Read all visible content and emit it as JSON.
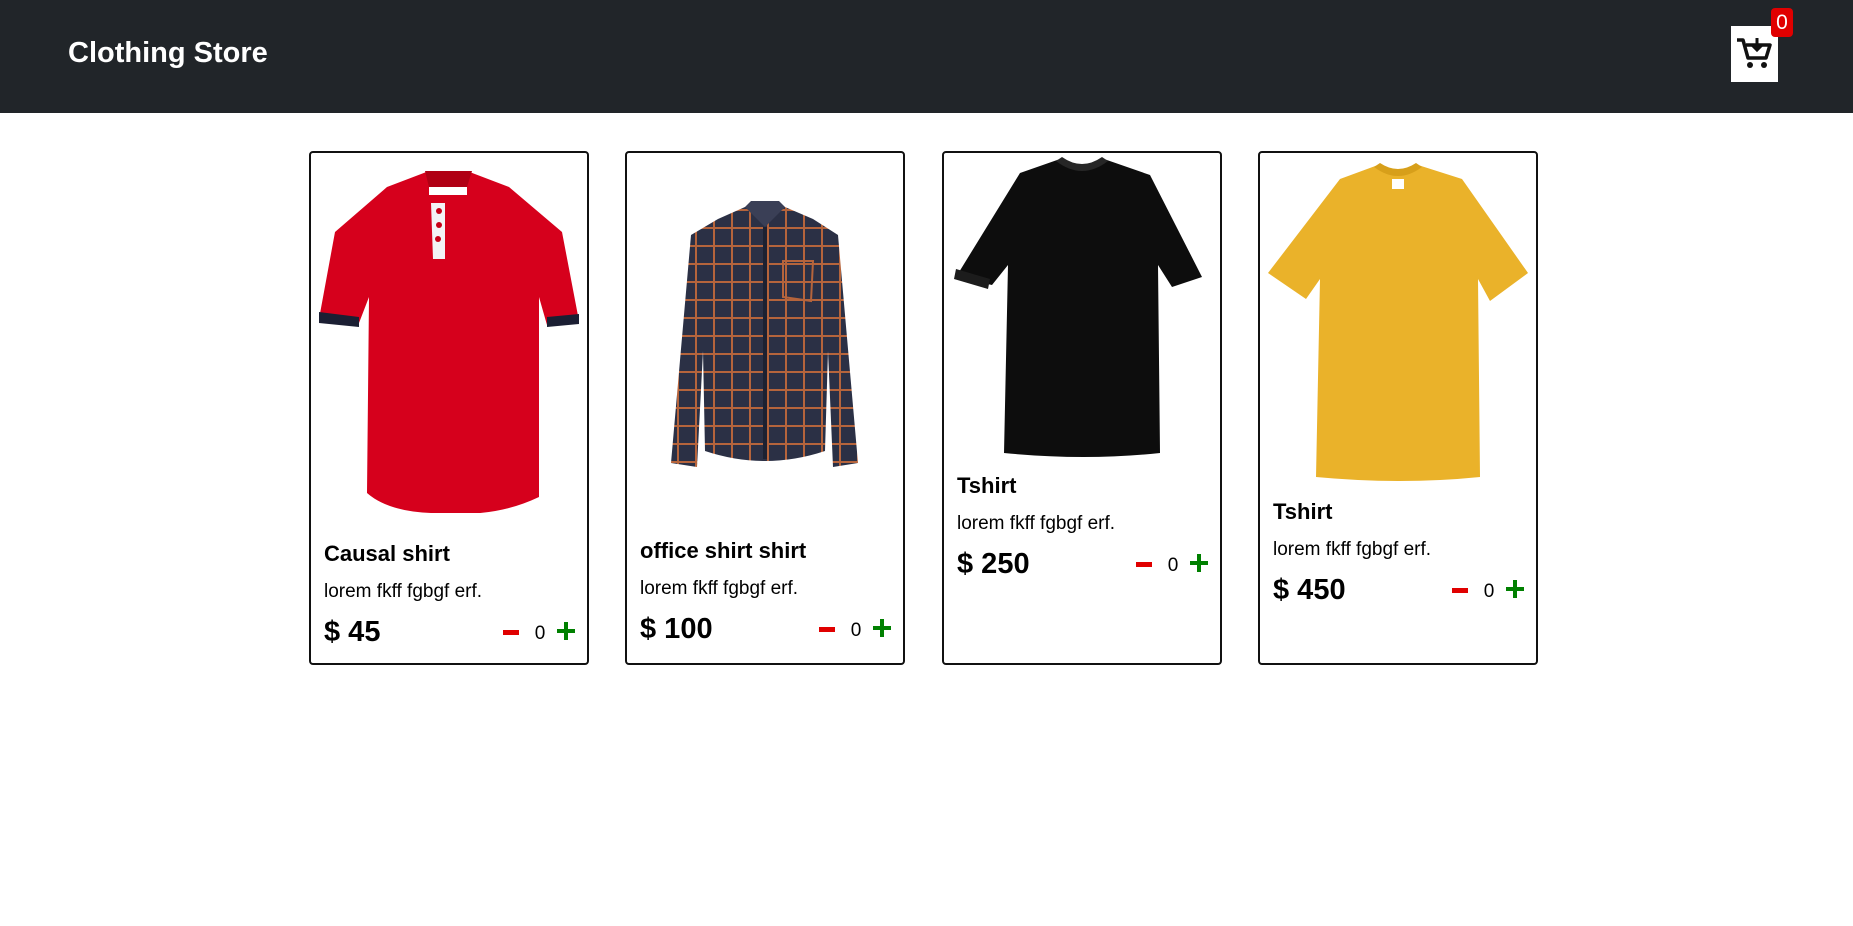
{
  "header": {
    "brand": "Clothing Store",
    "cart_icon": "cart-download-icon",
    "cart_count": "0",
    "background": "#212529"
  },
  "products": [
    {
      "image": "red-polo-shirt",
      "title": "Causal shirt",
      "desc": "lorem fkff fgbgf erf.",
      "price": "$ 45",
      "qty": "0"
    },
    {
      "image": "plaid-office-shirt",
      "title": "office shirt shirt",
      "desc": "lorem fkff fgbgf erf.",
      "price": "$ 100",
      "qty": "0"
    },
    {
      "image": "black-tshirt",
      "title": "Tshirt",
      "desc": "lorem fkff fgbgf erf.",
      "price": "$ 250",
      "qty": "0"
    },
    {
      "image": "yellow-tshirt",
      "title": "Tshirt",
      "desc": "lorem fkff fgbgf erf.",
      "price": "$ 450",
      "qty": "0"
    }
  ],
  "colors": {
    "minus": "#e00000",
    "plus": "#008000",
    "badge": "#e00000"
  }
}
